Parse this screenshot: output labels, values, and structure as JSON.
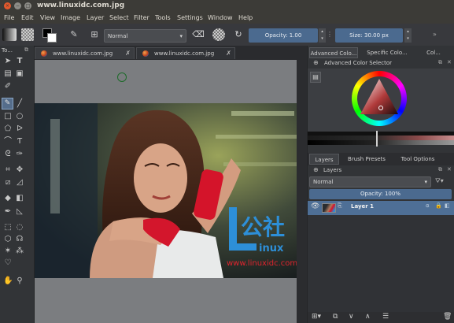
{
  "window": {
    "title": "www.linuxidc.com.jpg"
  },
  "menu": [
    "File",
    "Edit",
    "View",
    "Image",
    "Layer",
    "Select",
    "Filter",
    "Tools",
    "Settings",
    "Window",
    "Help"
  ],
  "toolbar": {
    "blend_mode": "Normal",
    "opacity_label": "Opacity:  1.00",
    "size_label": "Size:  30.00 px"
  },
  "toolbox_title": "To...",
  "tabs": [
    {
      "label": "www.linuxidc.com.jpg"
    },
    {
      "label": "www.linuxidc.com.jpg"
    }
  ],
  "watermark": {
    "big": "公社",
    "word": "inux",
    "url": "www.linuxidc.com"
  },
  "docker": {
    "top_tabs": [
      "Advanced Colo...",
      "Specific Colo...",
      "Col..."
    ],
    "selector_title": "Advanced Color Selector",
    "mid_tabs": [
      "Layers",
      "Brush Presets",
      "Tool Options"
    ],
    "layers_title": "Layers",
    "layers_blend": "Normal",
    "layers_opacity": "Opacity:  100%",
    "layer_name": "Layer 1"
  },
  "colors": {
    "accent": "#4b6a8f",
    "selected_layer": "#4e6f96",
    "watermark_blue": "#2d8fd8",
    "watermark_red": "#e0232d"
  }
}
